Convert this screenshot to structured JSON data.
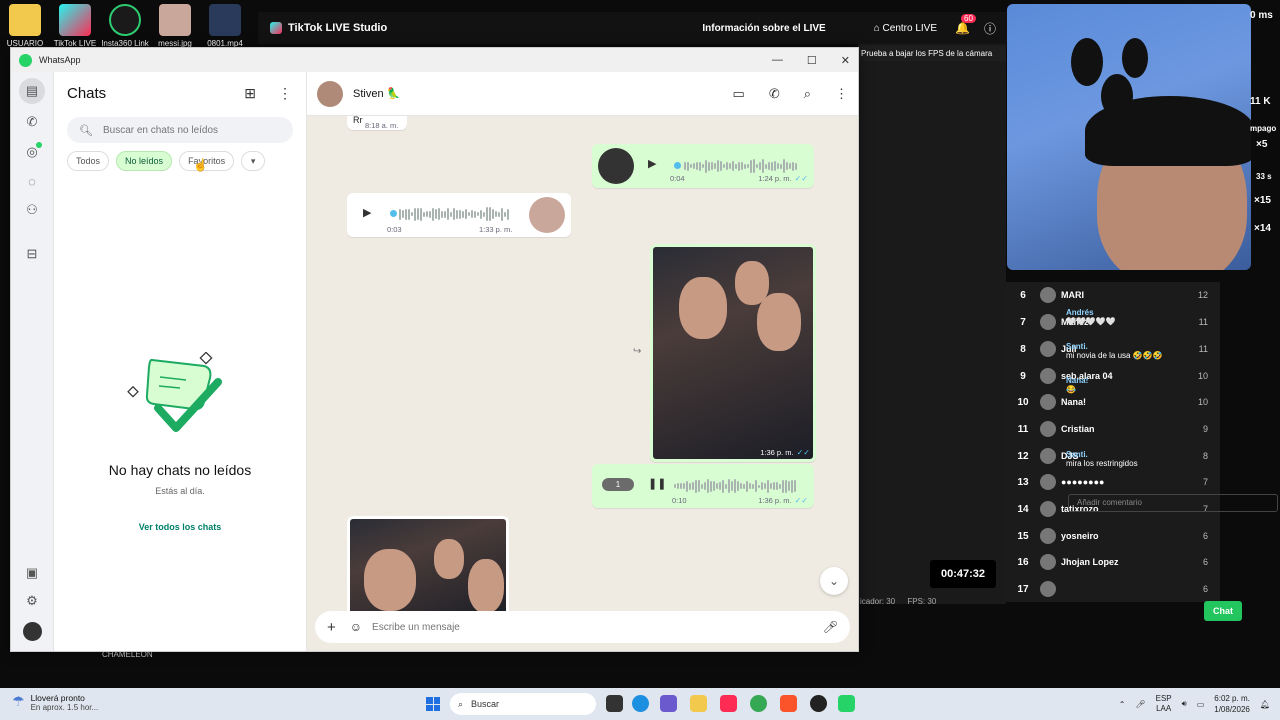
{
  "desktop": {
    "icons": [
      {
        "label": "USUARIO",
        "color": "#f2c94c"
      },
      {
        "label": "TikTok LIVE",
        "color": "#111111"
      },
      {
        "label": "Insta360 Link",
        "color": "#1a1a1a"
      },
      {
        "label": "messi.jpg",
        "color": "#c9a79a"
      },
      {
        "label": "0801.mp4",
        "color": "#2a3a5a"
      }
    ]
  },
  "tiktok": {
    "studio_title": "TikTok LIVE Studio",
    "info_live": "Información sobre el LIVE",
    "centro_live": "Centro LIVE",
    "notif_count": "60",
    "fps_warning": "Prueba a bajar los FPS de la cámara",
    "timer": "00:47:32",
    "stat_bitrate": "icador: 30",
    "stat_fps": "FPS: 30",
    "cam_time": "0 ms",
    "cam_viewers": "11 K",
    "cam_pay": "mpago",
    "cam_x5": "×5",
    "cam_33": "33 s",
    "cam_x15": "×15",
    "cam_x14": "×14",
    "chameleon": "CHAMELEON",
    "comment_placeholder": "Añadir comentario",
    "chat_button": "Chat",
    "leaderboard": [
      {
        "rank": "6",
        "name": "MARI",
        "score": "12"
      },
      {
        "rank": "7",
        "name": "Mañez",
        "score": "11"
      },
      {
        "rank": "8",
        "name": "Juli",
        "score": "11"
      },
      {
        "rank": "9",
        "name": "seb.alara 04",
        "score": "10"
      },
      {
        "rank": "10",
        "name": "Nana!",
        "score": "10"
      },
      {
        "rank": "11",
        "name": "Cristian",
        "score": "9"
      },
      {
        "rank": "12",
        "name": "DJS",
        "score": "8"
      },
      {
        "rank": "13",
        "name": "●●●●●●●●",
        "score": "7"
      },
      {
        "rank": "14",
        "name": "tatixrozo",
        "score": "7"
      },
      {
        "rank": "15",
        "name": "yosneiro",
        "score": "6"
      },
      {
        "rank": "16",
        "name": "Jhojan Lopez",
        "score": "6"
      },
      {
        "rank": "17",
        "name": "",
        "score": "6"
      }
    ],
    "comments": [
      {
        "user": "Andrés",
        "text": "🤍🤍🤍🤍🤍"
      },
      {
        "user": "Santi.",
        "text": "mi novia de la usa 🤣🤣🤣"
      },
      {
        "user": "Nana!",
        "text": "😂"
      },
      {
        "user": "Santi.",
        "text": "mira los restringidos"
      }
    ]
  },
  "whatsapp": {
    "window_title": "WhatsApp",
    "window_controls": [
      "—",
      "☐",
      "✕"
    ],
    "list": {
      "title": "Chats",
      "search_placeholder": "Buscar en chats no leídos",
      "filters": [
        "Todos",
        "No leídos",
        "Favoritos"
      ],
      "active_filter": "No leídos",
      "empty_title": "No hay chats no leídos",
      "empty_subtitle": "Estás al día.",
      "empty_link": "Ver todos los chats"
    },
    "chat": {
      "contact_name": "Stiven 🦜",
      "top_partial_text": "Rr",
      "top_partial_time": "8:18 a. m.",
      "messages": [
        {
          "type": "voice",
          "direction": "out",
          "duration": "0:04",
          "time": "1:24 p. m."
        },
        {
          "type": "voice",
          "direction": "in",
          "duration": "0:03",
          "time": "1:33 p. m."
        },
        {
          "type": "photo",
          "direction": "out",
          "time": "1:36 p. m."
        },
        {
          "type": "voice",
          "direction": "out",
          "duration": "0:10",
          "time": "1:36 p. m.",
          "speed": "1",
          "playing": true
        }
      ],
      "compose_placeholder": "Escribe un mensaje"
    },
    "accent": "#25d366"
  },
  "taskbar": {
    "weather_title": "Lloverá pronto",
    "weather_sub": "En aprox. 1.5 hor...",
    "search_label": "Buscar",
    "lang_top": "ESP",
    "lang_bottom": "LAA",
    "time": "6:02 p. m.",
    "date": "1/08/2026"
  }
}
